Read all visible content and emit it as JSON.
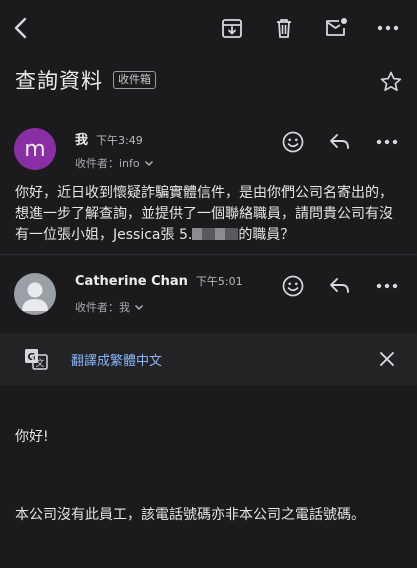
{
  "toolbar": {
    "back": "back-icon",
    "archive": "archive-icon",
    "delete": "trash-icon",
    "mark_unread": "mail-unread-icon",
    "more": "more-icon"
  },
  "subject": {
    "title": "查詢資料",
    "label": "收件箱"
  },
  "message1": {
    "avatar_letter": "m",
    "avatar_color": "#8a2fa3",
    "sender": "我",
    "time": "下午3:49",
    "recipients": "收件者：info",
    "body_part1": "你好，近日收到懷疑詐騙實體信件，是由你們公司名寄出的，想進一步了解查詢，並提供了一個聯絡職員，請問貴公司有沒有一位張小姐，Jessica張  5.",
    "body_part2": "的職員？"
  },
  "message2": {
    "sender": "Catherine Chan",
    "time": "下午5:01",
    "recipients": "收件者：我"
  },
  "translate": {
    "link": "翻譯成繁體中文"
  },
  "reply": {
    "greeting": "你好!",
    "text": "本公司沒有此員工，該電話號碼亦非本公司之電話號碼。"
  },
  "colors": {
    "background": "#1b1b1d",
    "link": "#8ab4f8",
    "translate_bar": "#232325"
  }
}
